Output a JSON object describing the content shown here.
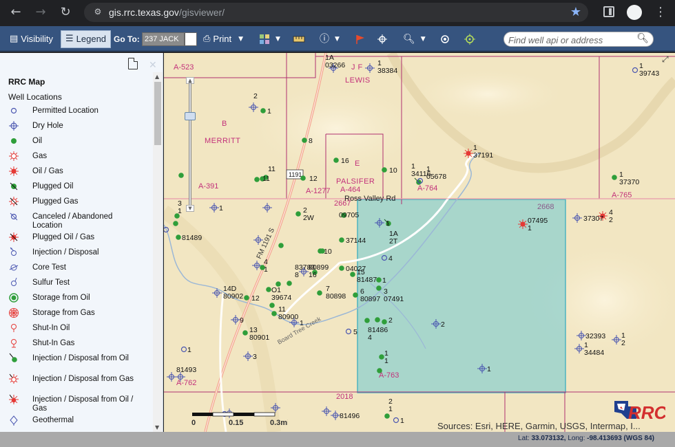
{
  "browser": {
    "url_host": "gis.rrc.texas.gov",
    "url_path": "/gisviewer/"
  },
  "toolbar": {
    "visibility_label": "Visibility",
    "legend_label": "Legend",
    "goto_label": "Go To:",
    "goto_value": "237 JACK",
    "print_label": "Print",
    "search_placeholder": "Find well api or address"
  },
  "legend": {
    "title": "RRC Map",
    "subtitle": "Well Locations",
    "items": [
      {
        "label": "Permitted Location",
        "icon": "permitted-location-icon"
      },
      {
        "label": "Dry Hole",
        "icon": "dry-hole-icon"
      },
      {
        "label": "Oil",
        "icon": "oil-icon"
      },
      {
        "label": "Gas",
        "icon": "gas-icon"
      },
      {
        "label": "Oil / Gas",
        "icon": "oil-gas-icon"
      },
      {
        "label": "Plugged Oil",
        "icon": "plugged-oil-icon"
      },
      {
        "label": "Plugged Gas",
        "icon": "plugged-gas-icon"
      },
      {
        "label": "Canceled / Abandoned Location",
        "icon": "canceled-location-icon"
      },
      {
        "label": "Plugged Oil / Gas",
        "icon": "plugged-oil-gas-icon"
      },
      {
        "label": "Injection / Disposal",
        "icon": "injection-disposal-icon"
      },
      {
        "label": "Core Test",
        "icon": "core-test-icon"
      },
      {
        "label": "Sulfur Test",
        "icon": "sulfur-test-icon"
      },
      {
        "label": "Storage from Oil",
        "icon": "storage-oil-icon"
      },
      {
        "label": "Storage from Gas",
        "icon": "storage-gas-icon"
      },
      {
        "label": "Shut-In Oil",
        "icon": "shut-in-oil-icon"
      },
      {
        "label": "Shut-In Gas",
        "icon": "shut-in-gas-icon"
      },
      {
        "label": "Injection / Disposal from Oil",
        "icon": "injection-oil-icon"
      },
      {
        "label": "Injection / Disposal from Gas",
        "icon": "injection-gas-icon"
      },
      {
        "label": "Injection / Disposal from Oil / Gas",
        "icon": "injection-oil-gas-icon"
      },
      {
        "label": "Geothermal",
        "icon": "geothermal-icon"
      }
    ]
  },
  "map": {
    "surveys": [
      "A-523",
      "J F",
      "LEWIS",
      "B",
      "MERRITT",
      "E",
      "PALSIFER",
      "A-464",
      "A-1277",
      "A-391",
      "A-764",
      "A-765",
      "A-762",
      "A-763"
    ],
    "roads": [
      "Ross Valley Rd",
      "FM 1191 S",
      "1191",
      "2667",
      "2668",
      "2018",
      "Board Tree Creek"
    ],
    "well_labels": [
      "1A",
      "03266",
      "1",
      "38384",
      "2",
      "1",
      "8",
      "11",
      "11",
      "16",
      "12",
      "10",
      "1",
      "34116",
      "1",
      "05678",
      "1",
      "37191",
      "1",
      "39743",
      "1",
      "37370",
      "1",
      "3",
      "1",
      "81489",
      "2",
      "2W",
      "09705",
      "1",
      "1A",
      "2T",
      "07495",
      "1",
      "37307",
      "4",
      "2",
      "37144",
      "4",
      "1",
      "10",
      "83783",
      "8",
      "80899",
      "16",
      "04027",
      "15",
      "81487",
      "1",
      "3",
      "07491",
      "4",
      "14D",
      "80902",
      "12",
      "O1",
      "39674",
      "7",
      "80898",
      "6",
      "80897",
      "11",
      "80900",
      "1",
      "9",
      "13",
      "80901",
      "5",
      "3",
      "2",
      "81486",
      "4",
      "2",
      "3",
      "1",
      "81493",
      "1",
      "1",
      "1",
      "32393",
      "1",
      "34484",
      "1",
      "2",
      "1",
      "81496",
      "2",
      "1",
      "1"
    ],
    "zoom_level": 0.27,
    "scale_labels": [
      "0",
      "0.15",
      "0.3mi"
    ],
    "attribution": "Sources: Esri, HERE, Garmin, USGS, Intermap, I..."
  },
  "status": {
    "lat_label": "Lat:",
    "lat": "33.073132",
    "long_label": "Long:",
    "long": "-98.413693",
    "datum": "(WGS 84)"
  },
  "colors": {
    "toolbar": "#36547f",
    "panel": "#f2f6fb",
    "map_base": "#f2e6c2",
    "selection": "#6cc9d4",
    "oil_well": "#2f9e3a",
    "gas_well": "#e53935",
    "permitted": "#4a56b0",
    "survey_line": "#b03070"
  }
}
